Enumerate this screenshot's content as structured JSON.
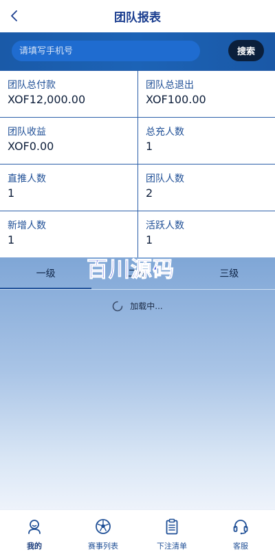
{
  "header": {
    "title": "团队报表",
    "back_icon": "chevron-left-icon"
  },
  "search": {
    "placeholder": "请填写手机号",
    "value": "",
    "button_label": "搜索"
  },
  "stats": [
    {
      "label": "团队总付款",
      "value": "XOF12,000.00"
    },
    {
      "label": "团队总退出",
      "value": "XOF100.00"
    },
    {
      "label": "团队收益",
      "value": "XOF0.00"
    },
    {
      "label": "总充人数",
      "value": "1"
    },
    {
      "label": "直推人数",
      "value": "1"
    },
    {
      "label": "团队人数",
      "value": "2"
    },
    {
      "label": "新增人数",
      "value": "1"
    },
    {
      "label": "活跃人数",
      "value": "1"
    }
  ],
  "tabs": [
    {
      "label": "一级",
      "active": true
    },
    {
      "label": "二级",
      "active": false
    },
    {
      "label": "三级",
      "active": false
    }
  ],
  "loading": {
    "text": "加载中..."
  },
  "watermark": "百川源码",
  "bottom_nav": [
    {
      "label": "我的",
      "icon": "user-icon",
      "active": true
    },
    {
      "label": "赛事列表",
      "icon": "soccer-ball-icon",
      "active": false
    },
    {
      "label": "下注清单",
      "icon": "clipboard-icon",
      "active": false
    },
    {
      "label": "客服",
      "icon": "headset-icon",
      "active": false
    }
  ],
  "colors": {
    "primary": "#1c63b6",
    "title": "#1a3d8f",
    "search_button": "#0b1f3b",
    "watermark": "#1a2ed6"
  }
}
